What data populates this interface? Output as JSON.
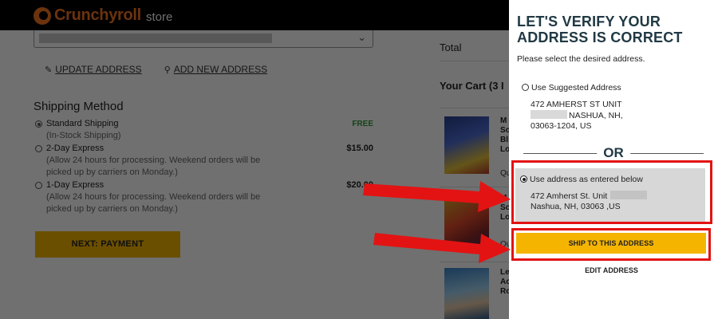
{
  "brand": {
    "name": "Crunchyroll",
    "store": "store"
  },
  "address_links": {
    "update": "UPDATE ADDRESS",
    "add": "ADD NEW ADDRESS"
  },
  "shipping": {
    "title": "Shipping Method",
    "options": [
      {
        "label": "Standard Shipping",
        "note": "(In-Stock Shipping)",
        "price": "FREE",
        "selected": true
      },
      {
        "label": "2-Day Express",
        "note": "(Allow 24 hours for processing. Weekend orders will be picked up by carriers on Monday.)",
        "price": "$15.00",
        "selected": false
      },
      {
        "label": "1-Day Express",
        "note": "(Allow 24 hours for processing. Weekend orders will be picked up by carriers on Monday.)",
        "price": "$20.00",
        "selected": false
      }
    ],
    "next_label": "NEXT: PAYMENT"
  },
  "summary": {
    "total_label": "Total",
    "cart_title": "Your Cart (3 I",
    "items": [
      {
        "text": "M\nSo\nBl\nLo",
        "qty": "Qu",
        "colors": [
          "#2b3f8f",
          "#e6c13a"
        ]
      },
      {
        "text": "M\nSo\nLo",
        "qty": "Qu",
        "colors": [
          "#d8b128",
          "#8c2a2a"
        ]
      },
      {
        "text": "Le\nAc\nRo",
        "qty": "Qu",
        "colors": [
          "#3a84c9",
          "#9fd0ee"
        ]
      }
    ]
  },
  "modal": {
    "title": "LET'S VERIFY YOUR ADDRESS IS CORRECT",
    "subtitle": "Please select the desired address.",
    "suggested": {
      "label": "Use Suggested Address",
      "line1": "472 AMHERST ST UNIT",
      "line2": "NASHUA, NH,",
      "line3": "03063-1204, US"
    },
    "or": "OR",
    "entered": {
      "label": "Use address as entered below",
      "line1": "472 Amherst St. Unit",
      "line2": "Nashua, NH, 03063 ,US"
    },
    "ship_button": "SHIP TO THIS ADDRESS",
    "edit_link": "EDIT ADDRESS"
  },
  "colors": {
    "accent_yellow": "#f4b400",
    "brand_orange": "#f47521",
    "heading_navy": "#213944",
    "annotation_red": "#e31313"
  }
}
